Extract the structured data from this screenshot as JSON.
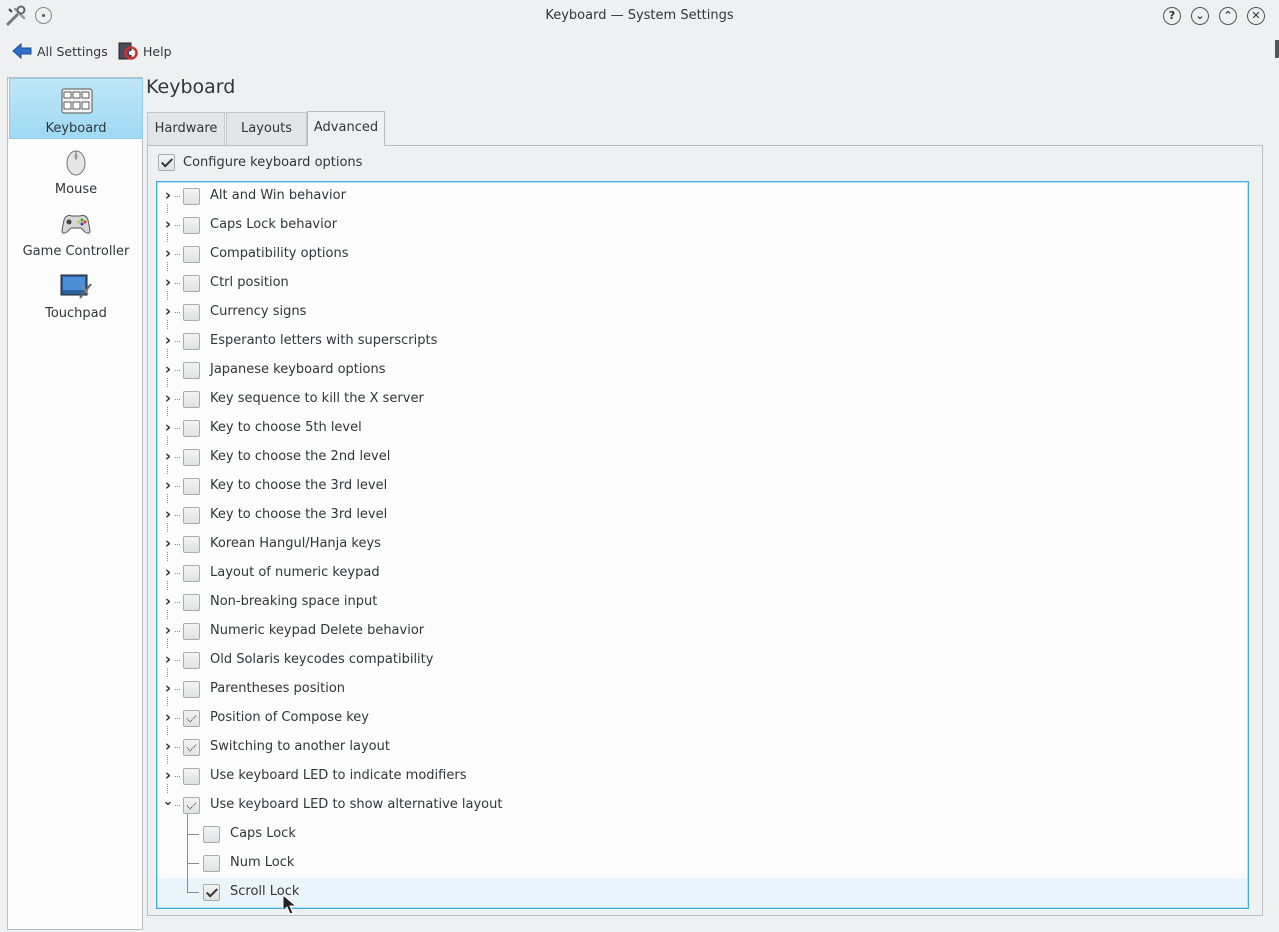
{
  "window": {
    "title": "Keyboard — System Settings",
    "buttons": [
      "?",
      "⌄",
      "⌃",
      "✕"
    ]
  },
  "toolbar": {
    "back_label": "All Settings",
    "help_label": "Help"
  },
  "sidebar": {
    "items": [
      {
        "label": "Keyboard",
        "icon": "keyboard-icon",
        "selected": true
      },
      {
        "label": "Mouse",
        "icon": "mouse-icon",
        "selected": false
      },
      {
        "label": "Game Controller",
        "icon": "gamepad-icon",
        "selected": false
      },
      {
        "label": "Touchpad",
        "icon": "touchpad-icon",
        "selected": false
      }
    ]
  },
  "page": {
    "title": "Keyboard",
    "tabs": [
      "Hardware",
      "Layouts",
      "Advanced"
    ],
    "active_tab": "Advanced",
    "configure_label": "Configure keyboard options",
    "configure_checked": true
  },
  "options": [
    {
      "label": "Alt and Win behavior",
      "state": "off",
      "expanded": false
    },
    {
      "label": "Caps Lock behavior",
      "state": "off",
      "expanded": false
    },
    {
      "label": "Compatibility options",
      "state": "off",
      "expanded": false
    },
    {
      "label": "Ctrl position",
      "state": "off",
      "expanded": false
    },
    {
      "label": "Currency signs",
      "state": "off",
      "expanded": false
    },
    {
      "label": "Esperanto letters with superscripts",
      "state": "off",
      "expanded": false
    },
    {
      "label": "Japanese keyboard options",
      "state": "off",
      "expanded": false
    },
    {
      "label": "Key sequence to kill the X server",
      "state": "off",
      "expanded": false
    },
    {
      "label": "Key to choose 5th level",
      "state": "off",
      "expanded": false
    },
    {
      "label": "Key to choose the 2nd level",
      "state": "off",
      "expanded": false
    },
    {
      "label": "Key to choose the 3rd level",
      "state": "off",
      "expanded": false
    },
    {
      "label": "Key to choose the 3rd level",
      "state": "off",
      "expanded": false
    },
    {
      "label": "Korean Hangul/Hanja keys",
      "state": "off",
      "expanded": false
    },
    {
      "label": "Layout of numeric keypad",
      "state": "off",
      "expanded": false
    },
    {
      "label": "Non-breaking space input",
      "state": "off",
      "expanded": false
    },
    {
      "label": "Numeric keypad Delete behavior",
      "state": "off",
      "expanded": false
    },
    {
      "label": "Old Solaris keycodes compatibility",
      "state": "off",
      "expanded": false
    },
    {
      "label": "Parentheses position",
      "state": "off",
      "expanded": false
    },
    {
      "label": "Position of Compose key",
      "state": "partial",
      "expanded": false
    },
    {
      "label": "Switching to another layout",
      "state": "partial",
      "expanded": false
    },
    {
      "label": "Use keyboard LED to indicate modifiers",
      "state": "off",
      "expanded": false
    },
    {
      "label": "Use keyboard LED to show alternative layout",
      "state": "partial",
      "expanded": true,
      "children": [
        {
          "label": "Caps Lock",
          "state": "off"
        },
        {
          "label": "Num Lock",
          "state": "off"
        },
        {
          "label": "Scroll Lock",
          "state": "on",
          "highlighted": true
        }
      ]
    }
  ],
  "colors": {
    "accent": "#3daee9",
    "selection": "#9fd9f4",
    "text": "#31363b"
  }
}
